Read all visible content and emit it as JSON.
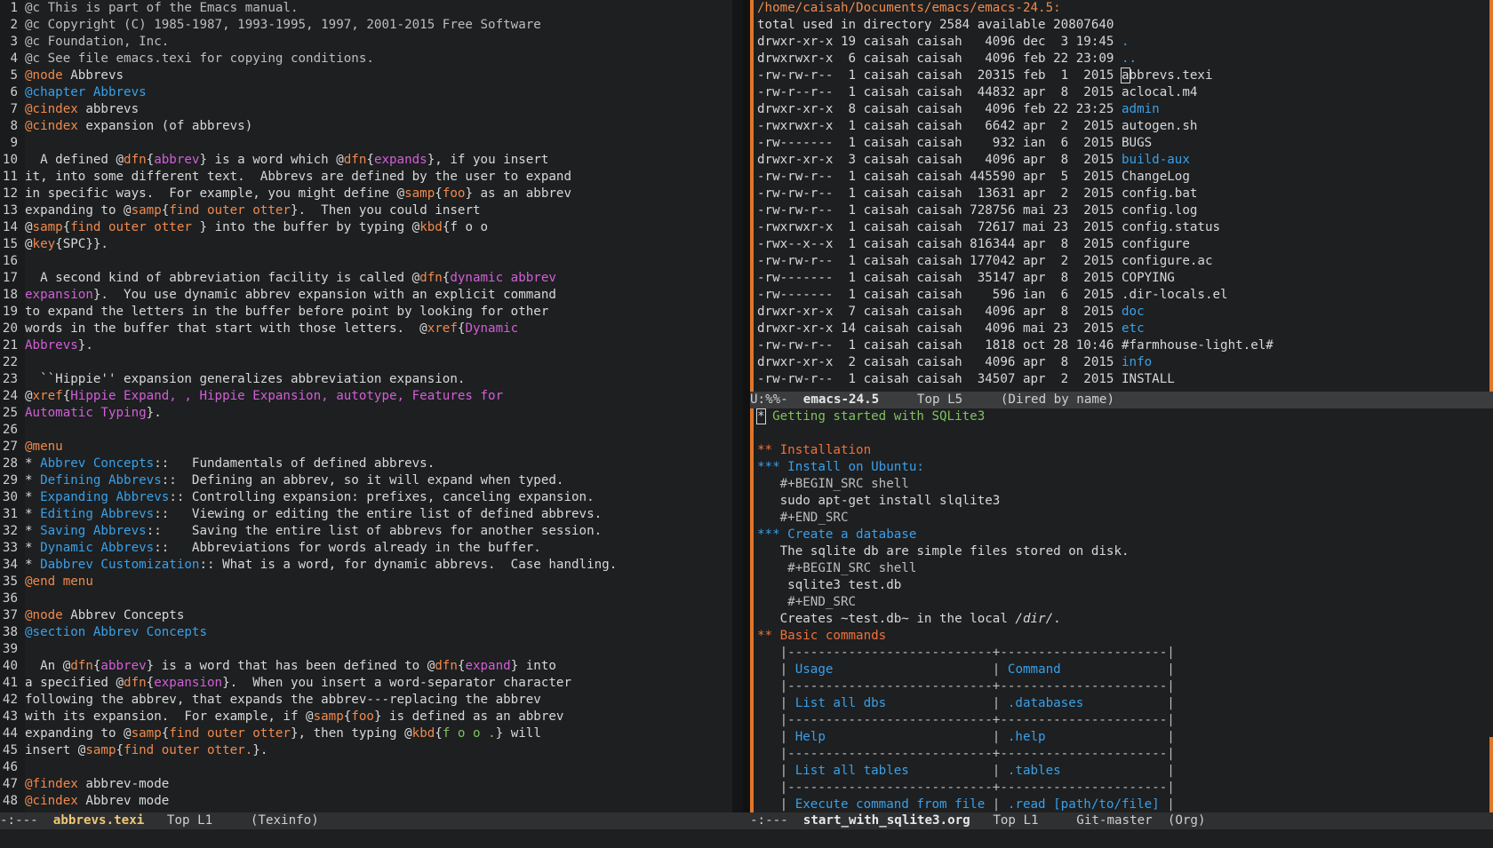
{
  "left_buffer": {
    "lines": [
      [
        [
          "@c This is part of the Emacs manual.",
          "comment"
        ]
      ],
      [
        [
          "@c Copyright (C) 1985-1987, 1993-1995, 1997, 2001-2015 Free Software",
          "comment"
        ]
      ],
      [
        [
          "@c Foundation, Inc.",
          "comment"
        ]
      ],
      [
        [
          "@c See file emacs.texi for copying conditions.",
          "comment"
        ]
      ],
      [
        [
          "@node",
          "kw"
        ],
        [
          " Abbrevs",
          ""
        ]
      ],
      [
        [
          "@chapter Abbrevs",
          "blue"
        ]
      ],
      [
        [
          "@cindex",
          "kw"
        ],
        [
          " abbrevs",
          ""
        ]
      ],
      [
        [
          "@cindex",
          "kw"
        ],
        [
          " expansion (of abbrevs)",
          ""
        ]
      ],
      [
        [
          "",
          ""
        ]
      ],
      [
        [
          "  A defined @",
          ""
        ],
        [
          "dfn",
          "kw"
        ],
        [
          "{",
          ""
        ],
        [
          "abbrev",
          "magenta"
        ],
        [
          "} is a word which @",
          ""
        ],
        [
          "dfn",
          "kw"
        ],
        [
          "{",
          ""
        ],
        [
          "expands",
          "magenta"
        ],
        [
          "}, if you insert",
          ""
        ]
      ],
      [
        [
          "it, into some different text.  Abbrevs are defined by the user to expand",
          ""
        ]
      ],
      [
        [
          "in specific ways.  For example, you might define @",
          ""
        ],
        [
          "samp",
          "kw"
        ],
        [
          "{",
          ""
        ],
        [
          "foo",
          "kw"
        ],
        [
          "} as an abbrev",
          ""
        ]
      ],
      [
        [
          "expanding to @",
          ""
        ],
        [
          "samp",
          "kw"
        ],
        [
          "{",
          ""
        ],
        [
          "find outer otter",
          "kw"
        ],
        [
          "}.  Then you could insert",
          ""
        ]
      ],
      [
        [
          "@",
          ""
        ],
        [
          "samp",
          "kw"
        ],
        [
          "{",
          ""
        ],
        [
          "find outer otter ",
          "kw"
        ],
        [
          "} into the buffer by typing @",
          ""
        ],
        [
          "kbd",
          "kw"
        ],
        [
          "{f o o",
          ""
        ]
      ],
      [
        [
          "@",
          ""
        ],
        [
          "key",
          "kw"
        ],
        [
          "{SPC}}.",
          ""
        ]
      ],
      [
        [
          "",
          ""
        ]
      ],
      [
        [
          "  A second kind of abbreviation facility is called @",
          ""
        ],
        [
          "dfn",
          "kw"
        ],
        [
          "{",
          ""
        ],
        [
          "dynamic abbrev",
          "magenta"
        ]
      ],
      [
        [
          "expansion",
          "magenta"
        ],
        [
          "}.  You use dynamic abbrev expansion with an explicit command",
          ""
        ]
      ],
      [
        [
          "to expand the letters in the buffer before point by looking for other",
          ""
        ]
      ],
      [
        [
          "words in the buffer that start with those letters.  @",
          ""
        ],
        [
          "xref",
          "kw"
        ],
        [
          "{",
          ""
        ],
        [
          "Dynamic",
          "magenta"
        ]
      ],
      [
        [
          "Abbrevs",
          "magenta"
        ],
        [
          "}.",
          ""
        ]
      ],
      [
        [
          "",
          ""
        ]
      ],
      [
        [
          "  ``Hippie'' expansion generalizes abbreviation expansion.",
          ""
        ]
      ],
      [
        [
          "@",
          ""
        ],
        [
          "xref",
          "kw"
        ],
        [
          "{",
          ""
        ],
        [
          "Hippie Expand, , Hippie Expansion, autotype, Features for",
          "magenta"
        ]
      ],
      [
        [
          "Automatic Typing",
          "magenta"
        ],
        [
          "}.",
          ""
        ]
      ],
      [
        [
          "",
          ""
        ]
      ],
      [
        [
          "@menu",
          "kw"
        ]
      ],
      [
        [
          "* ",
          ""
        ],
        [
          "Abbrev Concepts",
          "blue"
        ],
        [
          "::   Fundamentals of defined abbrevs.",
          ""
        ]
      ],
      [
        [
          "* ",
          ""
        ],
        [
          "Defining Abbrevs",
          "blue"
        ],
        [
          "::  Defining an abbrev, so it will expand when typed.",
          ""
        ]
      ],
      [
        [
          "* ",
          ""
        ],
        [
          "Expanding Abbrevs",
          "blue"
        ],
        [
          ":: Controlling expansion: prefixes, canceling expansion.",
          ""
        ]
      ],
      [
        [
          "* ",
          ""
        ],
        [
          "Editing Abbrevs",
          "blue"
        ],
        [
          "::   Viewing or editing the entire list of defined abbrevs.",
          ""
        ]
      ],
      [
        [
          "* ",
          ""
        ],
        [
          "Saving Abbrevs",
          "blue"
        ],
        [
          "::    Saving the entire list of abbrevs for another session.",
          ""
        ]
      ],
      [
        [
          "* ",
          ""
        ],
        [
          "Dynamic Abbrevs",
          "blue"
        ],
        [
          "::   Abbreviations for words already in the buffer.",
          ""
        ]
      ],
      [
        [
          "* ",
          ""
        ],
        [
          "Dabbrev Customization",
          "blue"
        ],
        [
          ":: What is a word, for dynamic abbrevs.  Case handling.",
          ""
        ]
      ],
      [
        [
          "@end menu",
          "kw"
        ]
      ],
      [
        [
          "",
          ""
        ]
      ],
      [
        [
          "@node",
          "kw"
        ],
        [
          " Abbrev Concepts",
          ""
        ]
      ],
      [
        [
          "@section Abbrev Concepts",
          "blue"
        ]
      ],
      [
        [
          "",
          ""
        ]
      ],
      [
        [
          "  An @",
          ""
        ],
        [
          "dfn",
          "kw"
        ],
        [
          "{",
          ""
        ],
        [
          "abbrev",
          "magenta"
        ],
        [
          "} is a word that has been defined to @",
          ""
        ],
        [
          "dfn",
          "kw"
        ],
        [
          "{",
          ""
        ],
        [
          "expand",
          "magenta"
        ],
        [
          "} into",
          ""
        ]
      ],
      [
        [
          "a specified @",
          ""
        ],
        [
          "dfn",
          "kw"
        ],
        [
          "{",
          ""
        ],
        [
          "expansion",
          "magenta"
        ],
        [
          "}.  When you insert a word-separator character",
          ""
        ]
      ],
      [
        [
          "following the abbrev, that expands the abbrev---replacing the abbrev",
          ""
        ]
      ],
      [
        [
          "with its expansion.  For example, if @",
          ""
        ],
        [
          "samp",
          "kw"
        ],
        [
          "{",
          ""
        ],
        [
          "foo",
          "kw"
        ],
        [
          "} is defined as an abbrev",
          ""
        ]
      ],
      [
        [
          "expanding to @",
          ""
        ],
        [
          "samp",
          "kw"
        ],
        [
          "{",
          ""
        ],
        [
          "find outer otter",
          "kw"
        ],
        [
          "}, then typing @",
          ""
        ],
        [
          "kbd",
          "kw"
        ],
        [
          "{",
          ""
        ],
        [
          "f o o .",
          "green"
        ],
        [
          "} will",
          ""
        ]
      ],
      [
        [
          "insert @",
          ""
        ],
        [
          "samp",
          "kw"
        ],
        [
          "{",
          ""
        ],
        [
          "find outer otter.",
          "kw"
        ],
        [
          "}.",
          ""
        ]
      ],
      [
        [
          "",
          ""
        ]
      ],
      [
        [
          "@findex",
          "kw"
        ],
        [
          " abbrev-mode",
          ""
        ]
      ],
      [
        [
          "@cindex",
          "kw"
        ],
        [
          " Abbrev mode",
          ""
        ]
      ]
    ],
    "modeline": {
      "state": "-:---  ",
      "buffer": "abbrevs.texi",
      "position": "   Top L1     ",
      "mode": "(Texinfo)"
    }
  },
  "dired": {
    "header": "/home/caisah/Documents/emacs/emacs-24.5:",
    "total": "total used in directory 2584 available 20807640",
    "entries": [
      {
        "meta": "drwxr-xr-x 19 caisah caisah   4096 dec  3 19:45 ",
        "name": ".",
        "type": "dir"
      },
      {
        "meta": "drwxrwxr-x  6 caisah caisah   4096 feb 22 23:09 ",
        "name": "..",
        "type": "dir"
      },
      {
        "meta": "-rw-rw-r--  1 caisah caisah  20315 feb  1  2015 ",
        "name": "abbrevs.texi",
        "type": "cursor"
      },
      {
        "meta": "-rw-r--r--  1 caisah caisah  44832 apr  8  2015 ",
        "name": "aclocal.m4",
        "type": "file"
      },
      {
        "meta": "drwxr-xr-x  8 caisah caisah   4096 feb 22 23:25 ",
        "name": "admin",
        "type": "dir"
      },
      {
        "meta": "-rwxrwxr-x  1 caisah caisah   6642 apr  2  2015 ",
        "name": "autogen.sh",
        "type": "file"
      },
      {
        "meta": "-rw-------  1 caisah caisah    932 ian  6  2015 ",
        "name": "BUGS",
        "type": "file"
      },
      {
        "meta": "drwxr-xr-x  3 caisah caisah   4096 apr  8  2015 ",
        "name": "build-aux",
        "type": "dir"
      },
      {
        "meta": "-rw-rw-r--  1 caisah caisah 445590 apr  5  2015 ",
        "name": "ChangeLog",
        "type": "file"
      },
      {
        "meta": "-rw-rw-r--  1 caisah caisah  13631 apr  2  2015 ",
        "name": "config.bat",
        "type": "file"
      },
      {
        "meta": "-rw-rw-r--  1 caisah caisah 728756 mai 23  2015 ",
        "name": "config.log",
        "type": "file"
      },
      {
        "meta": "-rwxrwxr-x  1 caisah caisah  72617 mai 23  2015 ",
        "name": "config.status",
        "type": "file"
      },
      {
        "meta": "-rwx--x--x  1 caisah caisah 816344 apr  8  2015 ",
        "name": "configure",
        "type": "file"
      },
      {
        "meta": "-rw-rw-r--  1 caisah caisah 177042 apr  2  2015 ",
        "name": "configure.ac",
        "type": "file"
      },
      {
        "meta": "-rw-------  1 caisah caisah  35147 apr  8  2015 ",
        "name": "COPYING",
        "type": "file"
      },
      {
        "meta": "-rw-------  1 caisah caisah    596 ian  6  2015 ",
        "name": ".dir-locals.el",
        "type": "file"
      },
      {
        "meta": "drwxr-xr-x  7 caisah caisah   4096 apr  8  2015 ",
        "name": "doc",
        "type": "dir"
      },
      {
        "meta": "drwxr-xr-x 14 caisah caisah   4096 mai 23  2015 ",
        "name": "etc",
        "type": "dir"
      },
      {
        "meta": "-rw-rw-r--  1 caisah caisah   1818 oct 28 10:46 ",
        "name": "#farmhouse-light.el#",
        "type": "file"
      },
      {
        "meta": "drwxr-xr-x  2 caisah caisah   4096 apr  8  2015 ",
        "name": "info",
        "type": "dir"
      },
      {
        "meta": "-rw-rw-r--  1 caisah caisah  34507 apr  2  2015 ",
        "name": "INSTALL",
        "type": "file"
      }
    ],
    "modeline": {
      "state": "U:%%-  ",
      "buffer": "emacs-24.5",
      "position": "     Top L5     ",
      "mode": "(Dired by name)"
    }
  },
  "org": {
    "lines": [
      [
        [
          "*",
          "cursor"
        ],
        [
          " Getting started with SQLite3",
          "green"
        ]
      ],
      [
        [
          "",
          ""
        ]
      ],
      [
        [
          "** Installation",
          "org1"
        ]
      ],
      [
        [
          "*** Install on Ubuntu:",
          "org2"
        ]
      ],
      [
        [
          "   #+BEGIN_SRC shell",
          "comment"
        ]
      ],
      [
        [
          "   sudo apt-get install slqlite3",
          ""
        ]
      ],
      [
        [
          "   #+END_SRC",
          "comment"
        ]
      ],
      [
        [
          "*** Create a database",
          "org2"
        ]
      ],
      [
        [
          "   The sqlite db are simple files stored on disk.",
          ""
        ]
      ],
      [
        [
          "    #+BEGIN_SRC shell",
          "comment"
        ]
      ],
      [
        [
          "    sqlite3 test.db",
          ""
        ]
      ],
      [
        [
          "    #+END_SRC",
          "comment"
        ]
      ],
      [
        [
          "   Creates ~test.db~ in the local ",
          ""
        ],
        [
          "/dir/",
          "italic"
        ],
        [
          ".",
          ""
        ]
      ],
      [
        [
          "** Basic commands",
          "org1"
        ]
      ],
      [
        [
          "   |---------------------------+----------------------|",
          "table"
        ]
      ],
      [
        [
          "   | ",
          "table"
        ],
        [
          "Usage",
          "blue"
        ],
        [
          "                     | ",
          "table"
        ],
        [
          "Command",
          "blue"
        ],
        [
          "              |",
          "table"
        ]
      ],
      [
        [
          "   |---------------------------+----------------------|",
          "table"
        ]
      ],
      [
        [
          "   | ",
          "table"
        ],
        [
          "List all dbs",
          "blue"
        ],
        [
          "              | ",
          "table"
        ],
        [
          ".databases",
          "blue"
        ],
        [
          "           |",
          "table"
        ]
      ],
      [
        [
          "   |---------------------------+----------------------|",
          "table"
        ]
      ],
      [
        [
          "   | ",
          "table"
        ],
        [
          "Help",
          "blue"
        ],
        [
          "                      | ",
          "table"
        ],
        [
          ".help",
          "blue"
        ],
        [
          "                |",
          "table"
        ]
      ],
      [
        [
          "   |---------------------------+----------------------|",
          "table"
        ]
      ],
      [
        [
          "   | ",
          "table"
        ],
        [
          "List all tables",
          "blue"
        ],
        [
          "           | ",
          "table"
        ],
        [
          ".tables",
          "blue"
        ],
        [
          "              |",
          "table"
        ]
      ],
      [
        [
          "   |---------------------------+----------------------|",
          "table"
        ]
      ],
      [
        [
          "   | ",
          "table"
        ],
        [
          "Execute command from file",
          "blue"
        ],
        [
          " | ",
          "table"
        ],
        [
          ".read [path/to/file]",
          "blue"
        ],
        [
          " |",
          "table"
        ]
      ]
    ],
    "modeline": {
      "state": "-:---  ",
      "buffer": "start_with_sqlite3.org",
      "position": "   Top L1     Git-master  ",
      "mode": "(Org)"
    }
  },
  "colors": {
    "background": "#1d1f21",
    "keyword": "#f08a4b",
    "link": "#3aa0e8",
    "string": "#d25fd6",
    "heading": "#7fc25b"
  }
}
